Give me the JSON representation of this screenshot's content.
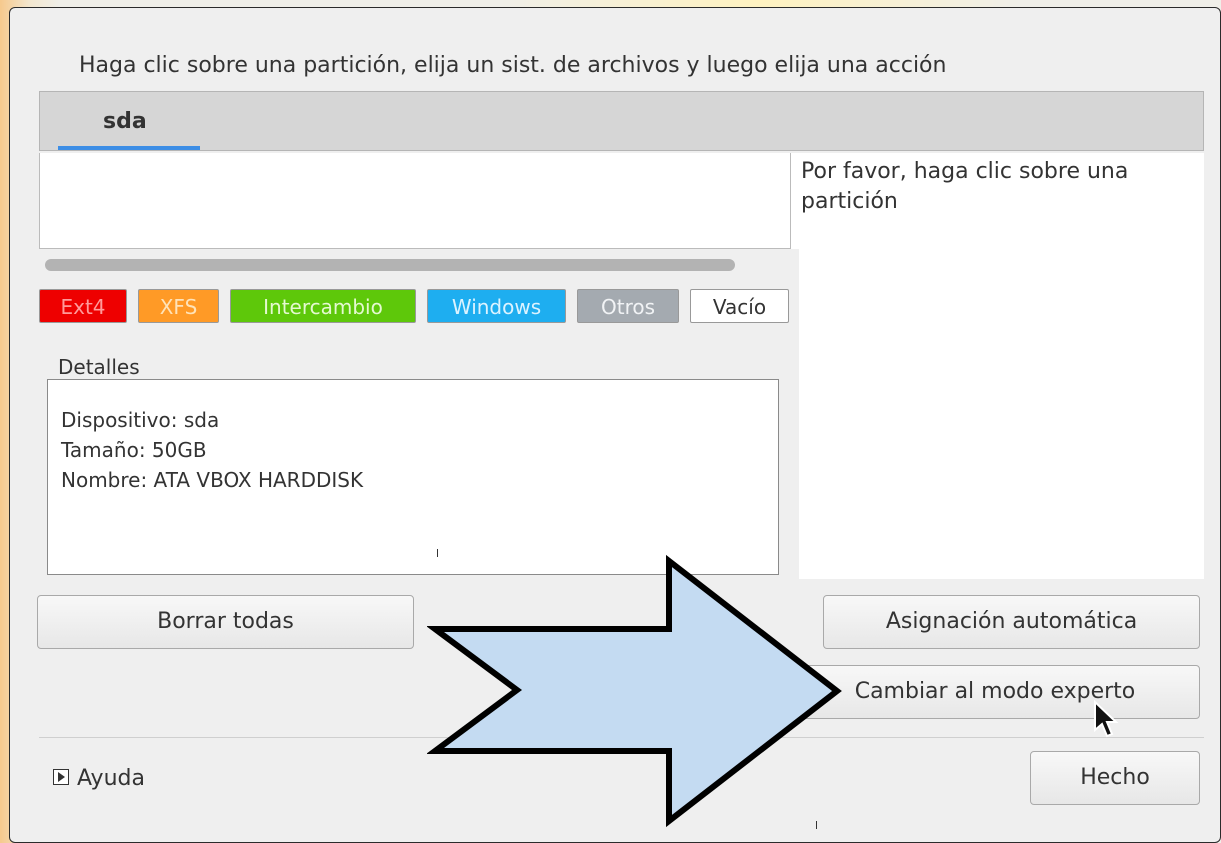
{
  "instruction": "Haga clic sobre una partición, elija un sist. de archivos y luego elija una acción",
  "tabs": [
    {
      "label": "sda",
      "selected": true
    }
  ],
  "hint": "Por favor, haga clic sobre una partición",
  "legend": [
    {
      "label": "Ext4",
      "bg": "#ee0000",
      "color": "#ff9a9a"
    },
    {
      "label": "XFS",
      "bg": "#ff9a26",
      "color": "#ffe3b8"
    },
    {
      "label": "Intercambio",
      "bg": "#5ec80a",
      "color": "#e4f9d0"
    },
    {
      "label": "Windows",
      "bg": "#1eaef0",
      "color": "#dcf3ff"
    },
    {
      "label": "Otros",
      "bg": "#a4aab0",
      "color": "#f1f3f5"
    },
    {
      "label": "Vacío",
      "bg": "#ffffff",
      "color": "#333333"
    }
  ],
  "details": {
    "title": "Detalles",
    "lines": [
      "Dispositivo: sda",
      "Tamaño: 50GB",
      "Nombre: ATA VBOX HARDDISK"
    ]
  },
  "buttons": {
    "clear_all": "Borrar todas",
    "auto_allocate": "Asignación automática",
    "expert_mode": "Cambiar al modo experto",
    "done": "Hecho"
  },
  "help": {
    "label": "Ayuda",
    "icon": "expander-triangle-icon"
  },
  "annotation": {
    "icon": "arrow-right-icon",
    "fill": "#c4dbf2",
    "stroke": "#000000"
  }
}
